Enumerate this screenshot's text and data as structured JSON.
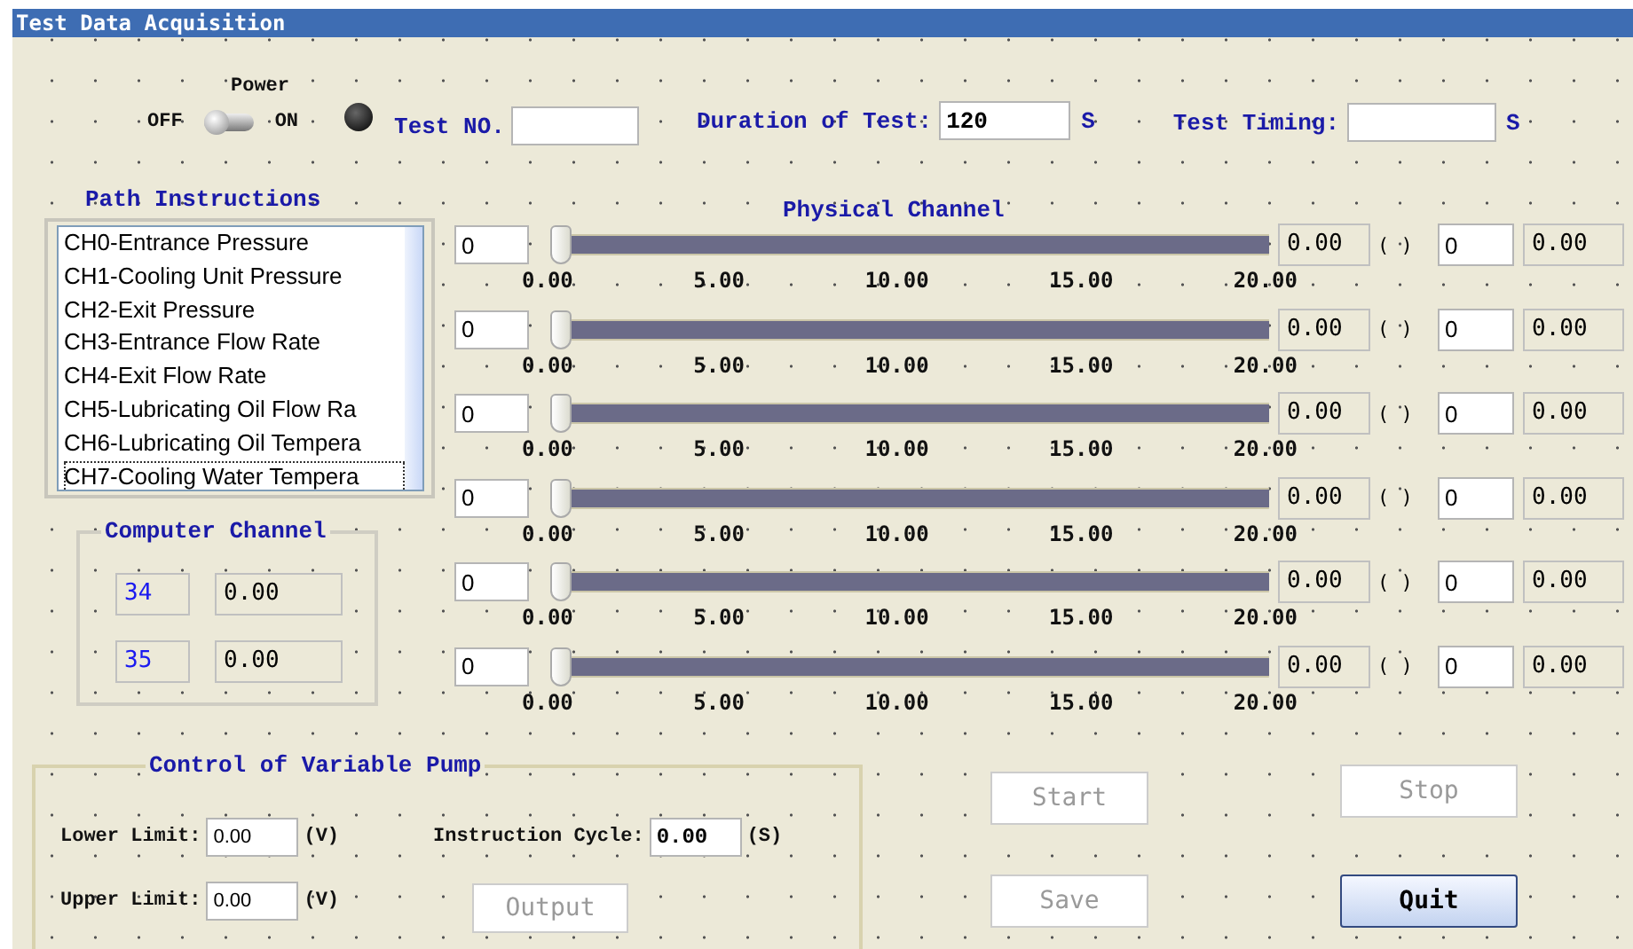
{
  "window": {
    "title": "Test Data Acquisition"
  },
  "power": {
    "label": "Power",
    "off_label": "OFF",
    "on_label": "ON",
    "on": false
  },
  "header_fields": [
    {
      "label": "Test NO."
    },
    {
      "label": "Duration of Test:",
      "value": "120",
      "unit": "S"
    },
    {
      "label": "Test Timing:",
      "unit": "S"
    }
  ],
  "path_instructions": {
    "title": "Path Instructions",
    "items": [
      {
        "text": "CH0-Entrance Pressure",
        "focused": false
      },
      {
        "text": "CH1-Cooling Unit Pressure",
        "focused": false
      },
      {
        "text": "CH2-Exit Pressure",
        "focused": false
      },
      {
        "text": "CH3-Entrance Flow Rate",
        "focused": false
      },
      {
        "text": "CH4-Exit Flow Rate",
        "focused": false
      },
      {
        "text": "CH5-Lubricating Oil Flow Ra",
        "focused": false
      },
      {
        "text": "CH6-Lubricating Oil Tempera",
        "focused": false
      },
      {
        "text": "CH7-Cooling Water Tempera",
        "focused": true
      }
    ]
  },
  "computer_channel": {
    "title": "Computer Channel",
    "rows": [
      {
        "channel": "34",
        "value": "0.00"
      },
      {
        "channel": "35",
        "value": "0.00"
      }
    ]
  },
  "physical_channel": {
    "title": "Physical Channel",
    "channels": [
      {
        "input": "0",
        "level": 0,
        "reading": "0.00",
        "unit": "( )",
        "channel": "0",
        "value": "0.00",
        "scale": [
          "0.00",
          "5.00",
          "10.00",
          "15.00",
          "20.00"
        ]
      },
      {
        "input": "0",
        "level": 0,
        "reading": "0.00",
        "unit": "( )",
        "channel": "0",
        "value": "0.00",
        "scale": [
          "0.00",
          "5.00",
          "10.00",
          "15.00",
          "20.00"
        ]
      },
      {
        "input": "0",
        "level": 0,
        "reading": "0.00",
        "unit": "( )",
        "channel": "0",
        "value": "0.00",
        "scale": [
          "0.00",
          "5.00",
          "10.00",
          "15.00",
          "20.00"
        ]
      },
      {
        "input": "0",
        "level": 0,
        "reading": "0.00",
        "unit": "( )",
        "channel": "0",
        "value": "0.00",
        "scale": [
          "0.00",
          "5.00",
          "10.00",
          "15.00",
          "20.00"
        ]
      },
      {
        "input": "0",
        "level": 0,
        "reading": "0.00",
        "unit": "( )",
        "channel": "0",
        "value": "0.00",
        "scale": [
          "0.00",
          "5.00",
          "10.00",
          "15.00",
          "20.00"
        ]
      },
      {
        "input": "0",
        "level": 0,
        "reading": "0.00",
        "unit": "( )",
        "channel": "0",
        "value": "0.00",
        "scale": [
          "0.00",
          "5.00",
          "10.00",
          "15.00",
          "20.00"
        ]
      }
    ]
  },
  "pump": {
    "title": "Control of Variable Pump",
    "lower_limit": {
      "label": "Lower Limit:",
      "value": "0.00",
      "unit": "(V)"
    },
    "upper_limit": {
      "label": "Upper Limit:",
      "value": "0.00",
      "unit": "(V)"
    },
    "instruction_cycle": {
      "label": "Instruction Cycle:",
      "value": "0.00",
      "unit": "(S)"
    },
    "output_button": {
      "label": "Output",
      "disabled": true
    }
  },
  "buttons": [
    {
      "label": "Start",
      "disabled": true
    },
    {
      "label": "Stop",
      "disabled": true
    },
    {
      "label": "Save",
      "disabled": true
    },
    {
      "label": "Quit",
      "disabled": false
    }
  ]
}
